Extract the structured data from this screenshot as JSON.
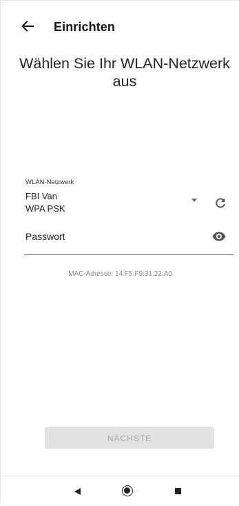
{
  "appbar": {
    "title": "Einrichten",
    "back_icon": "arrow-left-icon"
  },
  "heading": "Wählen Sie Ihr WLAN-Netzwerk aus",
  "network": {
    "label": "WLAN-Netzwerk",
    "selected_name": "FBI Van",
    "selected_security": "WPA PSK",
    "dropdown_icon": "caret-down-icon",
    "refresh_icon": "refresh-icon"
  },
  "password": {
    "placeholder": "Passwort",
    "value": "",
    "visibility_icon": "eye-icon"
  },
  "mac_address": "MAC-Adresse: 14:F5:F9:31:22:A0",
  "next_button": {
    "label": "NÄCHSTE",
    "enabled": false
  },
  "system_nav": {
    "back_icon": "triangle-back-icon",
    "home_icon": "circle-home-icon",
    "recents_icon": "square-recents-icon"
  },
  "colors": {
    "text_primary": "#222222",
    "text_secondary": "#8a8a8a",
    "button_disabled_bg": "#e2e2e2",
    "button_disabled_text": "#a6a6a6"
  }
}
